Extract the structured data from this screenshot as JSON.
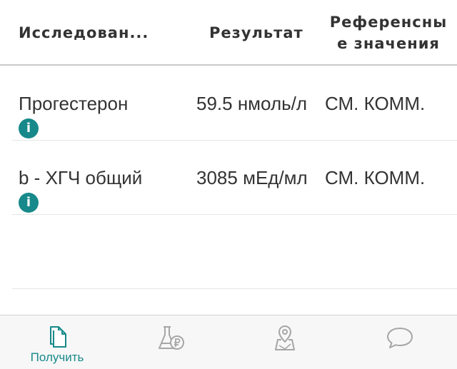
{
  "table": {
    "headers": {
      "study": "Исследован...",
      "result": "Результат",
      "reference_line1": "Референсны",
      "reference_line2": "е значения"
    },
    "rows": [
      {
        "name": "Прогестерон",
        "result": "59.5 нмоль/л",
        "reference": "СМ. КОММ.",
        "info": "i"
      },
      {
        "name": "b - ХГЧ общий",
        "result": "3085 мЕд/мл",
        "reference": "СМ. КОММ.",
        "info": "i"
      }
    ]
  },
  "tabbar": {
    "tabs": [
      {
        "label": "Получить",
        "icon": "documents-icon",
        "active": true
      },
      {
        "icon": "flask-ruble-icon",
        "active": false
      },
      {
        "icon": "map-pin-icon",
        "active": false
      },
      {
        "icon": "chat-bubble-icon",
        "active": false
      }
    ]
  },
  "colors": {
    "accent": "#17898a",
    "text": "#333333",
    "inactive_icon": "#a6a6a6",
    "tabbar_bg": "#f7f7f7"
  }
}
